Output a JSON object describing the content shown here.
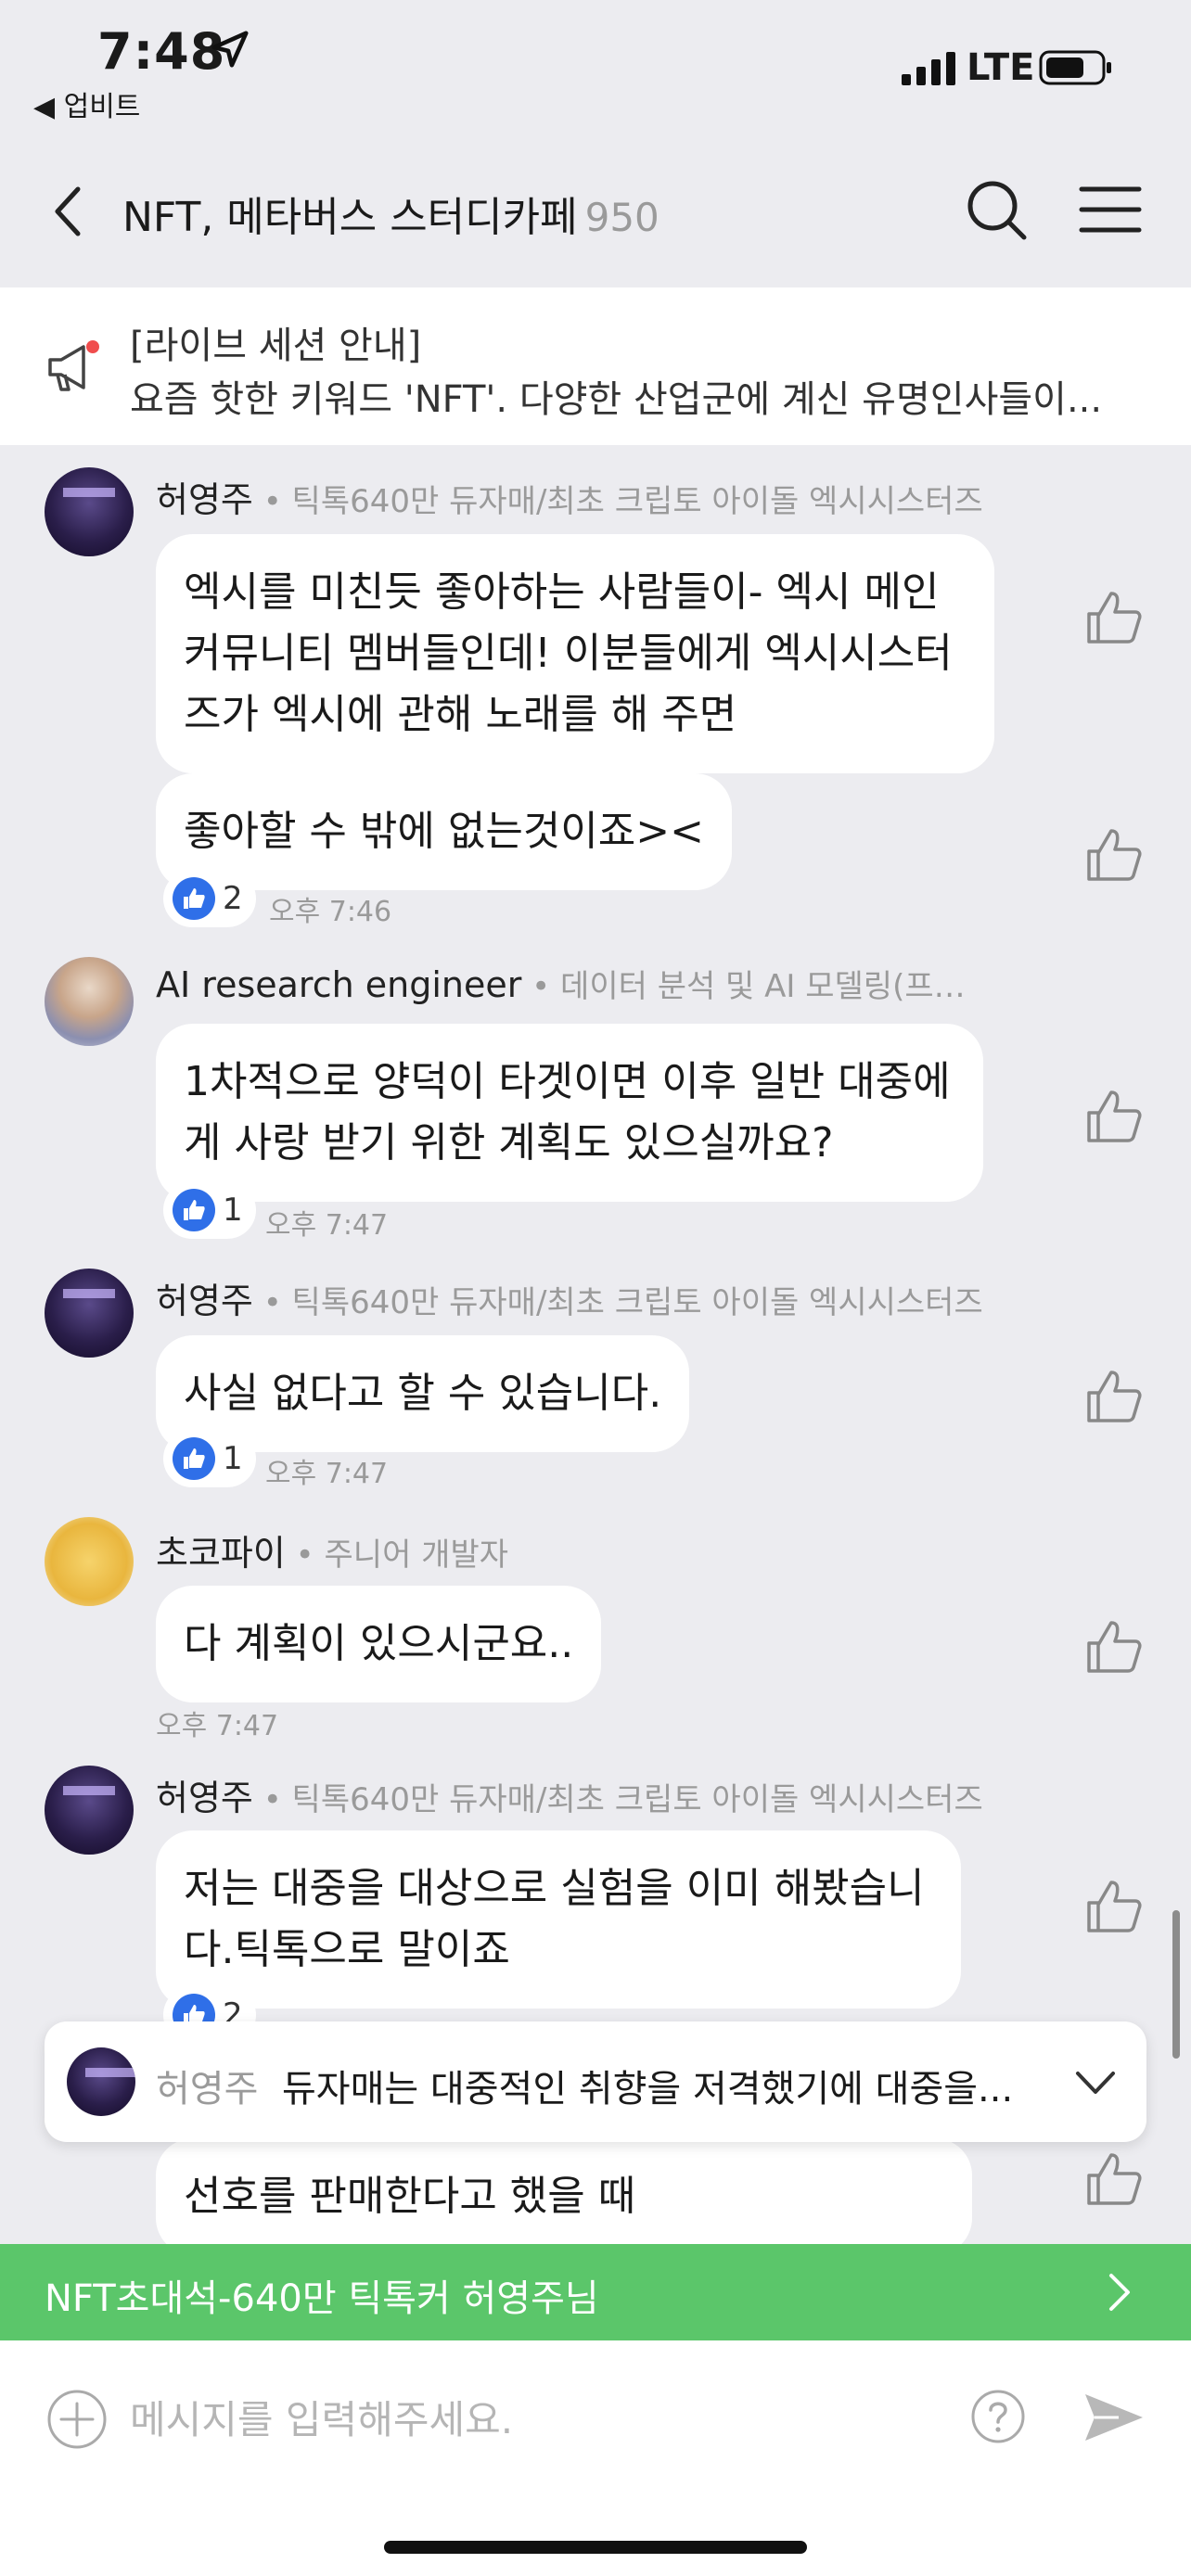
{
  "status_bar": {
    "time": "7:48",
    "back_app": "◀ 업비트",
    "network": "LTE"
  },
  "header": {
    "title": "NFT, 메타버스 스터디카페",
    "member_count": "950"
  },
  "notice": {
    "title": "[라이브 세션 안내]",
    "body": "요즘 핫한 키워드 'NFT'. 다양한 산업군에 계신 유명인사들이..."
  },
  "messages": [
    {
      "sender": "허영주",
      "role": " • 틱톡640만 듀자매/최초 크립토 아이돌 엑시시스터즈",
      "bubbles": [
        "엑시를 미친듯 좋아하는 사람들이- 엑시 메인\n커뮤니티 멤버들인데! 이분들에게 엑시시스터\n즈가 엑시에 관해 노래를 해 주면",
        "좋아할 수 밖에 없는것이죠><"
      ],
      "reactions": "2",
      "time": "오후 7:46"
    },
    {
      "sender": "AI research engineer",
      "role": " • 데이터 분석 및 AI 모델링(프…",
      "bubbles": [
        "1차적으로 양덕이 타겟이면 이후 일반 대중에\n게 사랑 받기 위한 계획도 있으실까요?"
      ],
      "reactions": "1",
      "time": "오후 7:47"
    },
    {
      "sender": "허영주",
      "role": " • 틱톡640만 듀자매/최초 크립토 아이돌 엑시시스터즈",
      "bubbles": [
        "사실 없다고 할 수 있습니다."
      ],
      "reactions": "1",
      "time": "오후 7:47"
    },
    {
      "sender": "초코파이",
      "role": " • 주니어 개발자",
      "bubbles": [
        "다 계획이 있으시군요.."
      ],
      "time": "오후 7:47"
    },
    {
      "sender": "허영주",
      "role": " • 틱톡640만 듀자매/최초 크립토 아이돌 엑시시스터즈",
      "bubbles": [
        "저는 대중을 대상으로 실험을 이미 해봤습니\n다.틱톡으로 말이죠",
        "선호를 판매한다고 했을 때"
      ],
      "reactions": "2"
    }
  ],
  "pinned": {
    "name": "허영주",
    "text": "듀자매는 대중적인 취향을 저격했기에 대중을..."
  },
  "live_banner": {
    "text": "NFT초대석-640만 틱톡커 허영주님"
  },
  "input": {
    "placeholder": "메시지를 입력해주세요."
  },
  "colors": {
    "background": "#ececf0",
    "accent_green": "#5bc66a",
    "reaction_blue": "#2f6fe8"
  }
}
